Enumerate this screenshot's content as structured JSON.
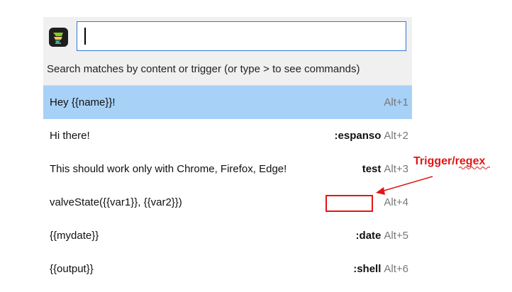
{
  "search": {
    "value": "",
    "placeholder": "",
    "hint": "Search matches by content or trigger (or type > to see commands)"
  },
  "matches": [
    {
      "label": "Hey {{name}}!",
      "trigger": "",
      "shortcut": "Alt+1",
      "selected": true
    },
    {
      "label": "Hi there!",
      "trigger": ":espanso",
      "shortcut": "Alt+2"
    },
    {
      "label": "This should work only with Chrome, Firefox, Edge!",
      "trigger": "test",
      "shortcut": "Alt+3"
    },
    {
      "label": "valveState({{var1}}, {{var2}})",
      "trigger": "",
      "shortcut": "Alt+4"
    },
    {
      "label": "{{mydate}}",
      "trigger": ":date",
      "shortcut": "Alt+5"
    },
    {
      "label": "{{output}}",
      "trigger": ":shell",
      "shortcut": "Alt+6"
    }
  ],
  "annotation": {
    "text": "Trigger/regex",
    "color": "#e01616"
  },
  "icons": {
    "app": "espanso-app-icon"
  },
  "colors": {
    "selected_row": "#a8d1f7",
    "search_border": "#2f7bd6",
    "header_bg": "#f0f0f0"
  }
}
